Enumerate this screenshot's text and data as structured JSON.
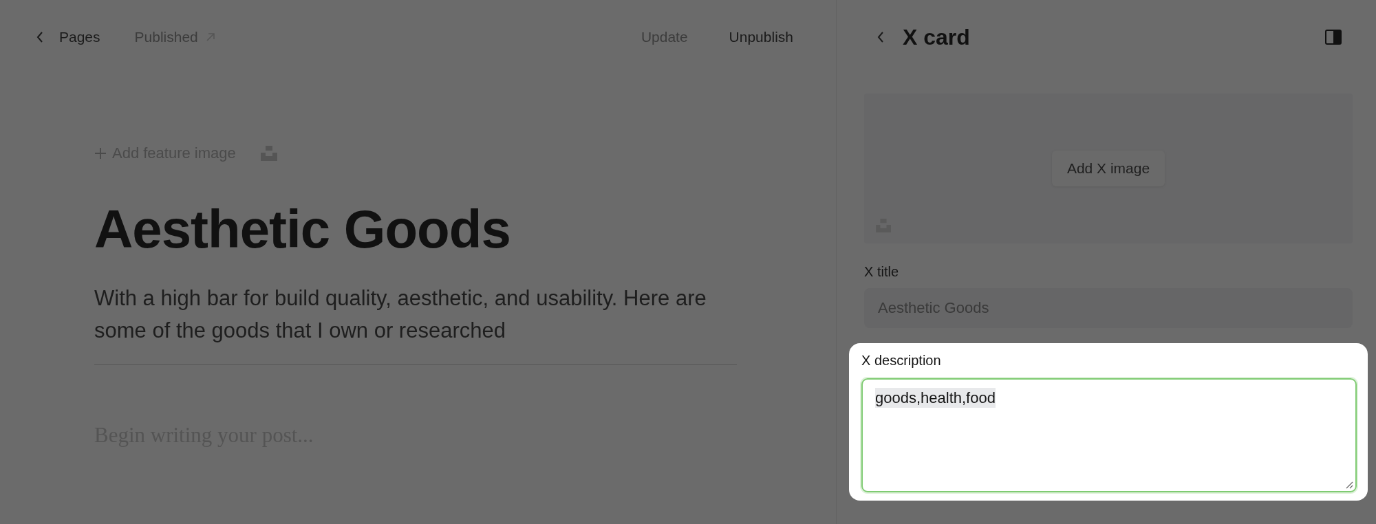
{
  "editor_header": {
    "back_label": "Pages",
    "status": "Published",
    "actions": [
      {
        "label": "Update",
        "disabled": true
      },
      {
        "label": "Unpublish",
        "disabled": false
      }
    ]
  },
  "editor": {
    "add_feature_image": "Add feature image",
    "title": "Aesthetic Goods",
    "excerpt": "With a high bar for build quality, aesthetic, and usability. Here are some of the goods that I own or researched",
    "body_placeholder": "Begin writing your post..."
  },
  "panel": {
    "title": "X card",
    "image_button": "Add X image",
    "x_title": {
      "label": "X title",
      "placeholder": "Aesthetic Goods"
    },
    "x_description": {
      "label": "X description",
      "value": "goods,health,food",
      "focused": true
    }
  }
}
